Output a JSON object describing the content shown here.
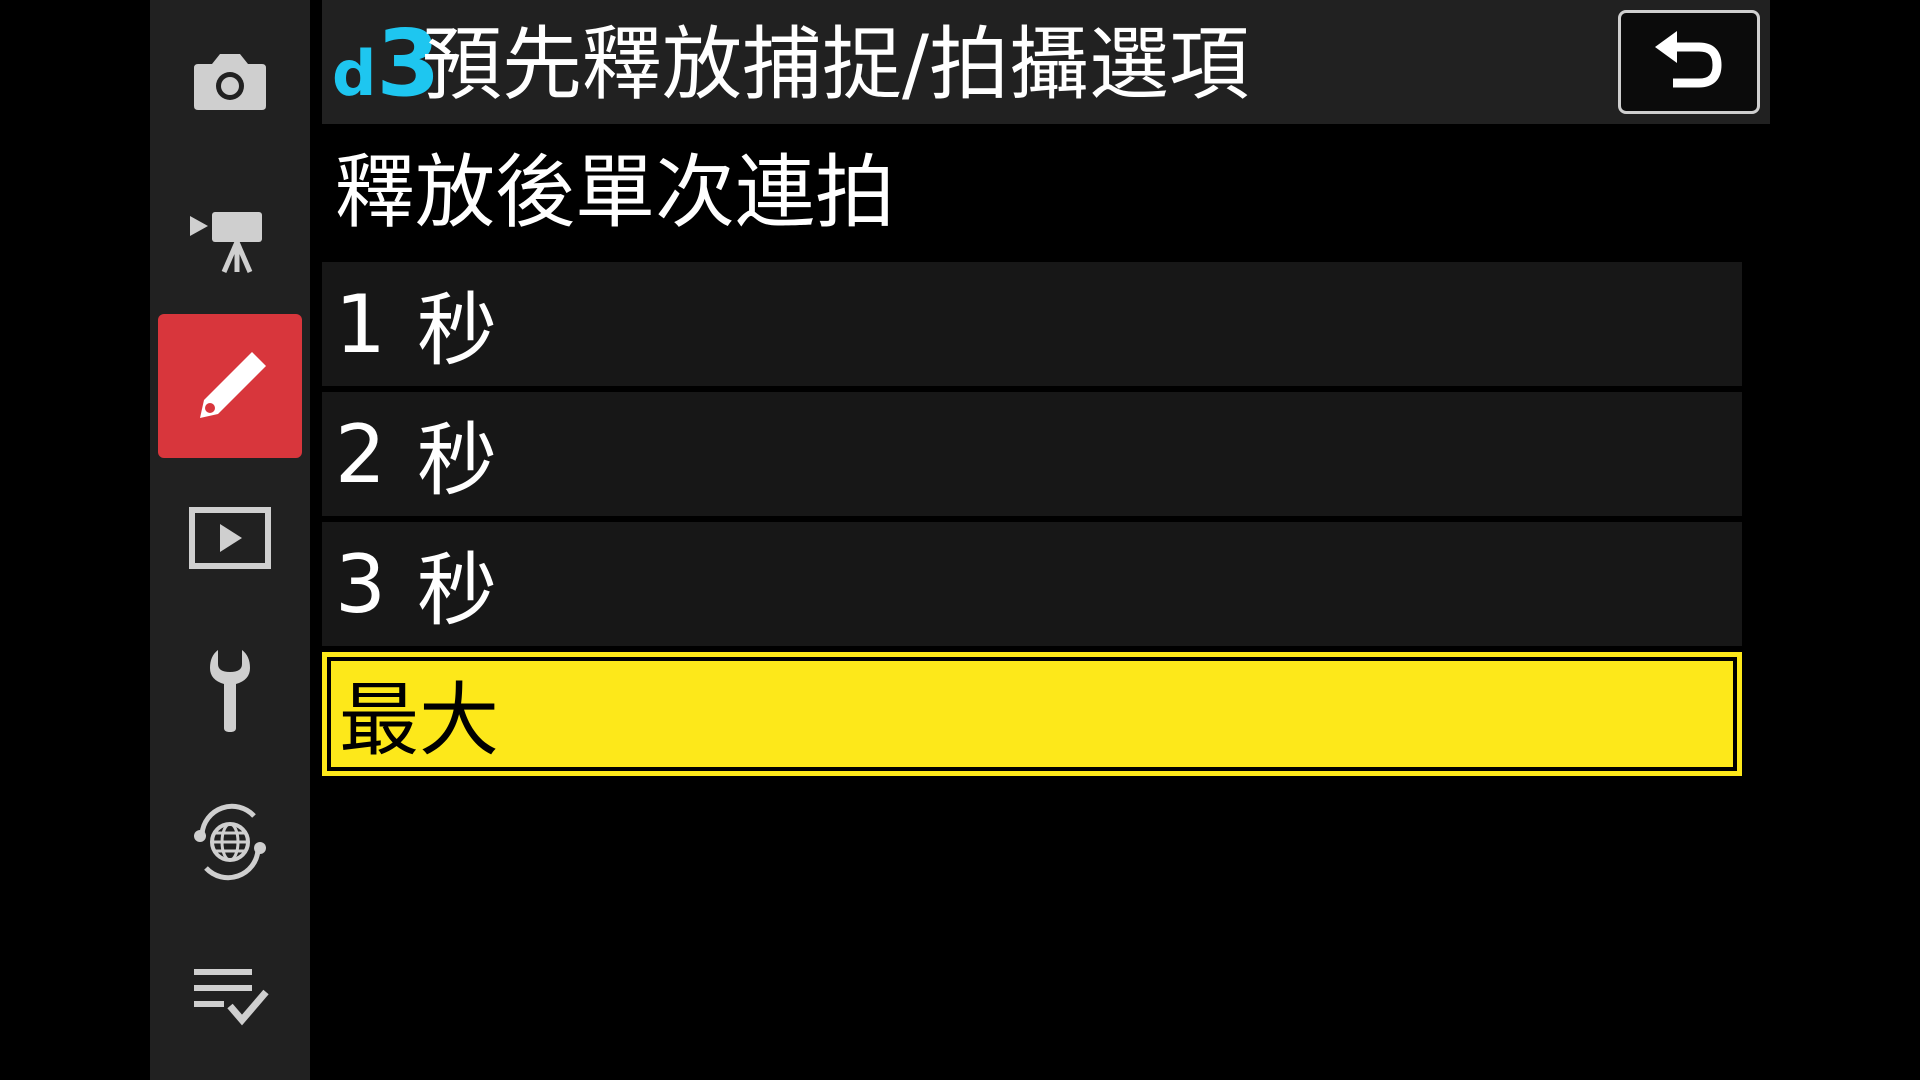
{
  "sidebar": {
    "items": [
      {
        "icon": "camera-icon"
      },
      {
        "icon": "movie-camera-icon"
      },
      {
        "icon": "pencil-icon",
        "active": true
      },
      {
        "icon": "playback-icon"
      },
      {
        "icon": "wrench-icon"
      },
      {
        "icon": "network-icon"
      },
      {
        "icon": "my-menu-icon"
      }
    ]
  },
  "header": {
    "code_letter": "d",
    "code_number": "3",
    "title": "預先釋放捕捉/拍攝選項",
    "back_icon": "back-arrow-icon"
  },
  "subtitle": "釋放後單次連拍",
  "options": [
    {
      "num": "1",
      "label": "秒",
      "selected": false
    },
    {
      "num": "2",
      "label": "秒",
      "selected": false
    },
    {
      "num": "3",
      "label": "秒",
      "selected": false
    },
    {
      "num": "",
      "label": "最大",
      "selected": true
    }
  ],
  "colors": {
    "accent_cyan": "#1ec6f0",
    "active_red": "#d8363c",
    "highlight_yellow": "#fde81a"
  }
}
